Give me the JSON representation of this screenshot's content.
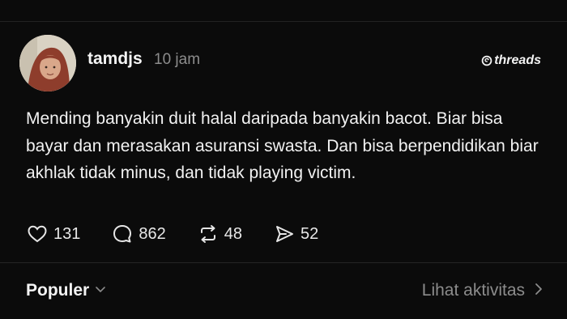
{
  "post": {
    "username": "tamdjs",
    "time": "10 jam",
    "brand": "threads",
    "text": "Mending banyakin duit halal daripada banyakin bacot. Biar bisa bayar dan merasakan asuransi swasta. Dan bisa berpendidikan biar akhlak tidak minus, dan tidak playing victim.",
    "actions": {
      "likes": "131",
      "replies": "862",
      "reposts": "48",
      "shares": "52"
    }
  },
  "footer": {
    "sort_label": "Populer",
    "activity_label": "Lihat aktivitas"
  },
  "icons": {
    "like": "heart-icon",
    "reply": "comment-icon",
    "repost": "repost-icon",
    "share": "send-icon",
    "sort": "chevron-down-icon",
    "activity": "chevron-right-icon",
    "brand": "threads-logo-icon"
  }
}
